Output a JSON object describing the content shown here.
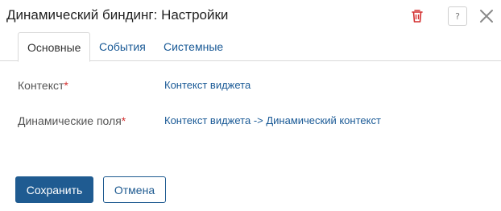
{
  "dialog": {
    "title": "Динамический биндинг: Настройки"
  },
  "header": {
    "delete_icon": "trash-icon",
    "help_icon": "help-icon",
    "help_glyph": "?",
    "close_icon": "close-icon",
    "delete_color": "#d32f2f"
  },
  "tabs": [
    {
      "label": "Основные",
      "active": true
    },
    {
      "label": "События",
      "active": false
    },
    {
      "label": "Системные",
      "active": false
    }
  ],
  "fields": [
    {
      "label": "Контекст",
      "required_mark": "*",
      "value": "Контекст виджета"
    },
    {
      "label": "Динамические поля",
      "required_mark": "*",
      "value": "Контекст виджета -> Динамический контекст"
    }
  ],
  "footer": {
    "save_label": "Сохранить",
    "cancel_label": "Отмена"
  },
  "colors": {
    "accent": "#1f5b91",
    "link": "#1a5a96",
    "required": "#d32f2f"
  }
}
